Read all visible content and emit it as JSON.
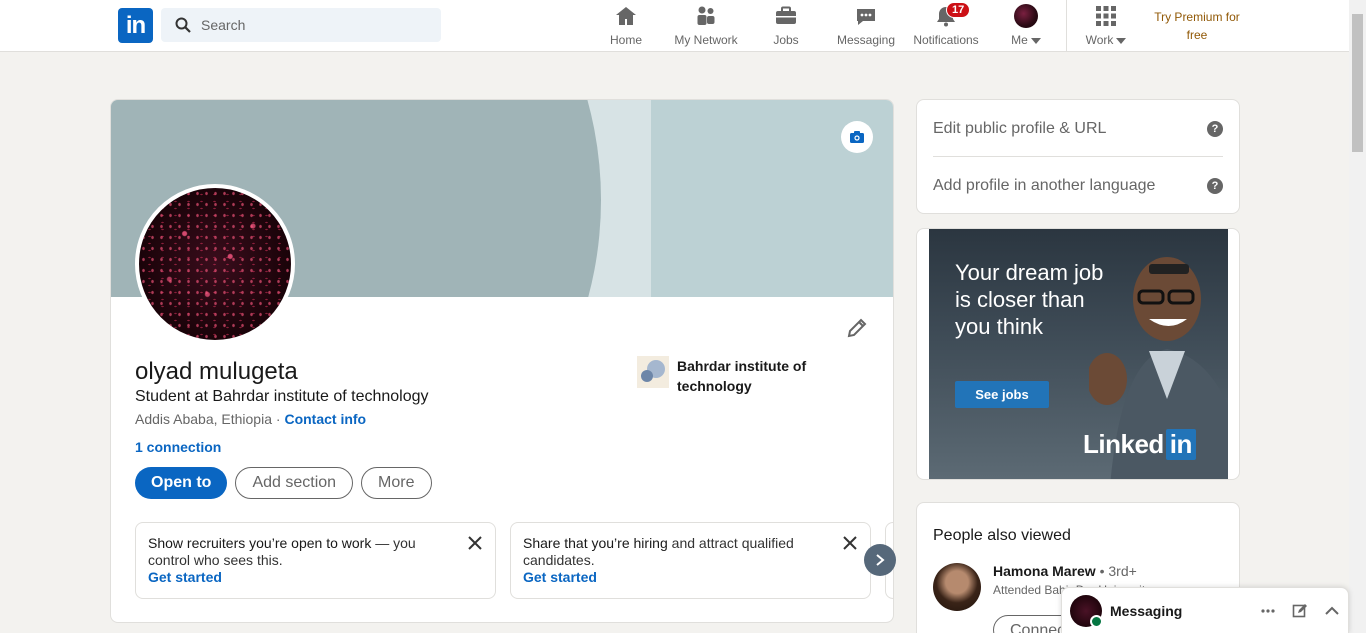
{
  "nav": {
    "logo_text": "in",
    "search_placeholder": "Search",
    "items": [
      {
        "label": "Home",
        "icon": "home-icon"
      },
      {
        "label": "My Network",
        "icon": "network-icon"
      },
      {
        "label": "Jobs",
        "icon": "briefcase-icon"
      },
      {
        "label": "Messaging",
        "icon": "chat-icon"
      },
      {
        "label": "Notifications",
        "icon": "bell-icon",
        "badge": "17"
      },
      {
        "label": "Me",
        "icon": "avatar"
      },
      {
        "label": "Work",
        "icon": "grid-icon"
      }
    ],
    "premium": "Try Premium for free"
  },
  "profile": {
    "name": "olyad mulugeta",
    "headline": "Student at Bahrdar institute of technology",
    "location": "Addis Ababa, Ethiopia",
    "separator": "·",
    "contact_info": "Contact info",
    "connections": "1 connection",
    "school": "Bahrdar institute of technology",
    "buttons": {
      "open_to": "Open to",
      "add_section": "Add section",
      "more": "More"
    },
    "suggestions": [
      {
        "bold": "Show recruiters you’re open to work",
        "rest": " — you control who sees this.",
        "cta": "Get started"
      },
      {
        "bold": "Share that you’re hiring",
        "rest": " and attract qualified candidates.",
        "cta": "Get started"
      }
    ]
  },
  "right_rail": {
    "edit_public_profile": "Edit public profile & URL",
    "add_language": "Add profile in another language",
    "help_glyph": "?",
    "ad": {
      "headline": "Your dream job is closer than you think",
      "cta": "See jobs",
      "brand": "Linked",
      "brand_in": "in"
    },
    "people_also_viewed": {
      "title": "People also viewed",
      "person": {
        "name": "Hamona Marew",
        "degree": "• 3rd+",
        "sub": "Attended Bahir Dar University",
        "cta": "Connect"
      }
    }
  },
  "messaging": {
    "title": "Messaging"
  },
  "colors": {
    "brand": "#0a66c2",
    "premium": "#915907",
    "badge": "#cc1016",
    "page_bg": "#f3f2ef"
  }
}
